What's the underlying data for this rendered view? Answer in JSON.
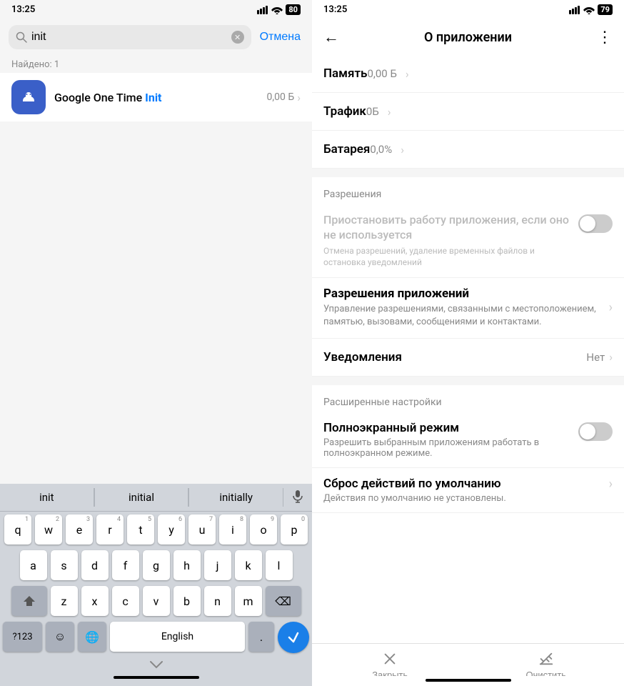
{
  "left": {
    "status_time": "13:25",
    "status_icons": "● ···",
    "search_value": "init",
    "cancel_label": "Отмена",
    "found_label": "Найдено: 1",
    "app": {
      "name_prefix": "Google One Time ",
      "name_highlight": "Init",
      "size": "0,00 Б"
    },
    "keyboard": {
      "suggestions": [
        "init",
        "initial",
        "initially"
      ],
      "rows": [
        [
          "q",
          "w",
          "e",
          "r",
          "t",
          "y",
          "u",
          "i",
          "o",
          "p"
        ],
        [
          "a",
          "s",
          "d",
          "f",
          "g",
          "h",
          "j",
          "k",
          "l"
        ],
        [
          "z",
          "x",
          "c",
          "v",
          "b",
          "n",
          "m"
        ]
      ],
      "nums": [
        "1",
        "2",
        "3",
        "4",
        "5",
        "6",
        "7",
        "8",
        "9",
        "0"
      ],
      "special_label": "?123",
      "emoji_label": "☺",
      "globe_label": "🌐",
      "space_label": "English",
      "period_label": ".",
      "backspace_label": "⌫"
    }
  },
  "right": {
    "status_time": "13:25",
    "status_icons": "● ···",
    "header_title": "О приложении",
    "memory_label": "Память",
    "memory_value": "0,00 Б",
    "traffic_label": "Трафик",
    "traffic_value": "0Б",
    "battery_label": "Батарея",
    "battery_value": "0,0%",
    "section_permissions": "Разрешения",
    "pause_title": "Приостановить работу приложения, если оно не используется",
    "pause_desc": "Отмена разрешений, удаление временных файлов и остановка уведомлений",
    "app_perms_title": "Разрешения приложений",
    "app_perms_desc": "Управление разрешениями, связанными с местоположением, памятью, вызовами, сообщениями и контактами.",
    "notif_label": "Уведомления",
    "notif_value": "Нет",
    "section_advanced": "Расширенные настройки",
    "fullscreen_title": "Полноэкранный режим",
    "fullscreen_desc": "Разрешить выбранным приложениям работать в полноэкранном режиме.",
    "reset_title": "Сброс действий по умолчанию",
    "reset_desc": "Действия по умолчанию не установлены.",
    "close_label": "Закрыть",
    "clear_label": "Очистить"
  }
}
